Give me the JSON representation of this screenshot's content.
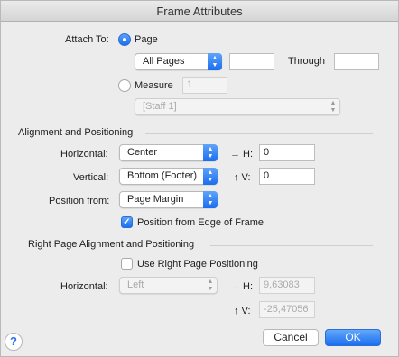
{
  "window": {
    "title": "Frame Attributes"
  },
  "attach": {
    "label": "Attach To:",
    "page_label": "Page",
    "pages_popup": "All Pages",
    "pages_from": "",
    "through_label": "Through",
    "pages_through": "",
    "measure_label": "Measure",
    "measure_value": "1",
    "staff_popup": "[Staff 1]"
  },
  "alignment": {
    "section_title": "Alignment and Positioning",
    "horizontal_label": "Horizontal:",
    "horizontal_value": "Center",
    "h_label": "→ H:",
    "h_value": "0",
    "vertical_label": "Vertical:",
    "vertical_value": "Bottom (Footer)",
    "v_label": "↑ V:",
    "v_value": "0",
    "position_from_label": "Position from:",
    "position_from_value": "Page Margin",
    "edge_checkbox_label": "Position from Edge of Frame"
  },
  "right_page": {
    "section_title": "Right Page Alignment and Positioning",
    "use_checkbox_label": "Use Right Page Positioning",
    "horizontal_label": "Horizontal:",
    "horizontal_value": "Left",
    "h_label": "→ H:",
    "h_value": "9,63083",
    "v_label": "↑ V:",
    "v_value": "-25,47056"
  },
  "buttons": {
    "help": "?",
    "cancel": "Cancel",
    "ok": "OK"
  },
  "icons": {
    "popup_arrows": "up-down-chevron-icon",
    "checkmark": "checkmark-icon",
    "radio": "radio-icon"
  },
  "colors": {
    "accent": "#1b6ff0",
    "window_bg": "#ececec"
  }
}
